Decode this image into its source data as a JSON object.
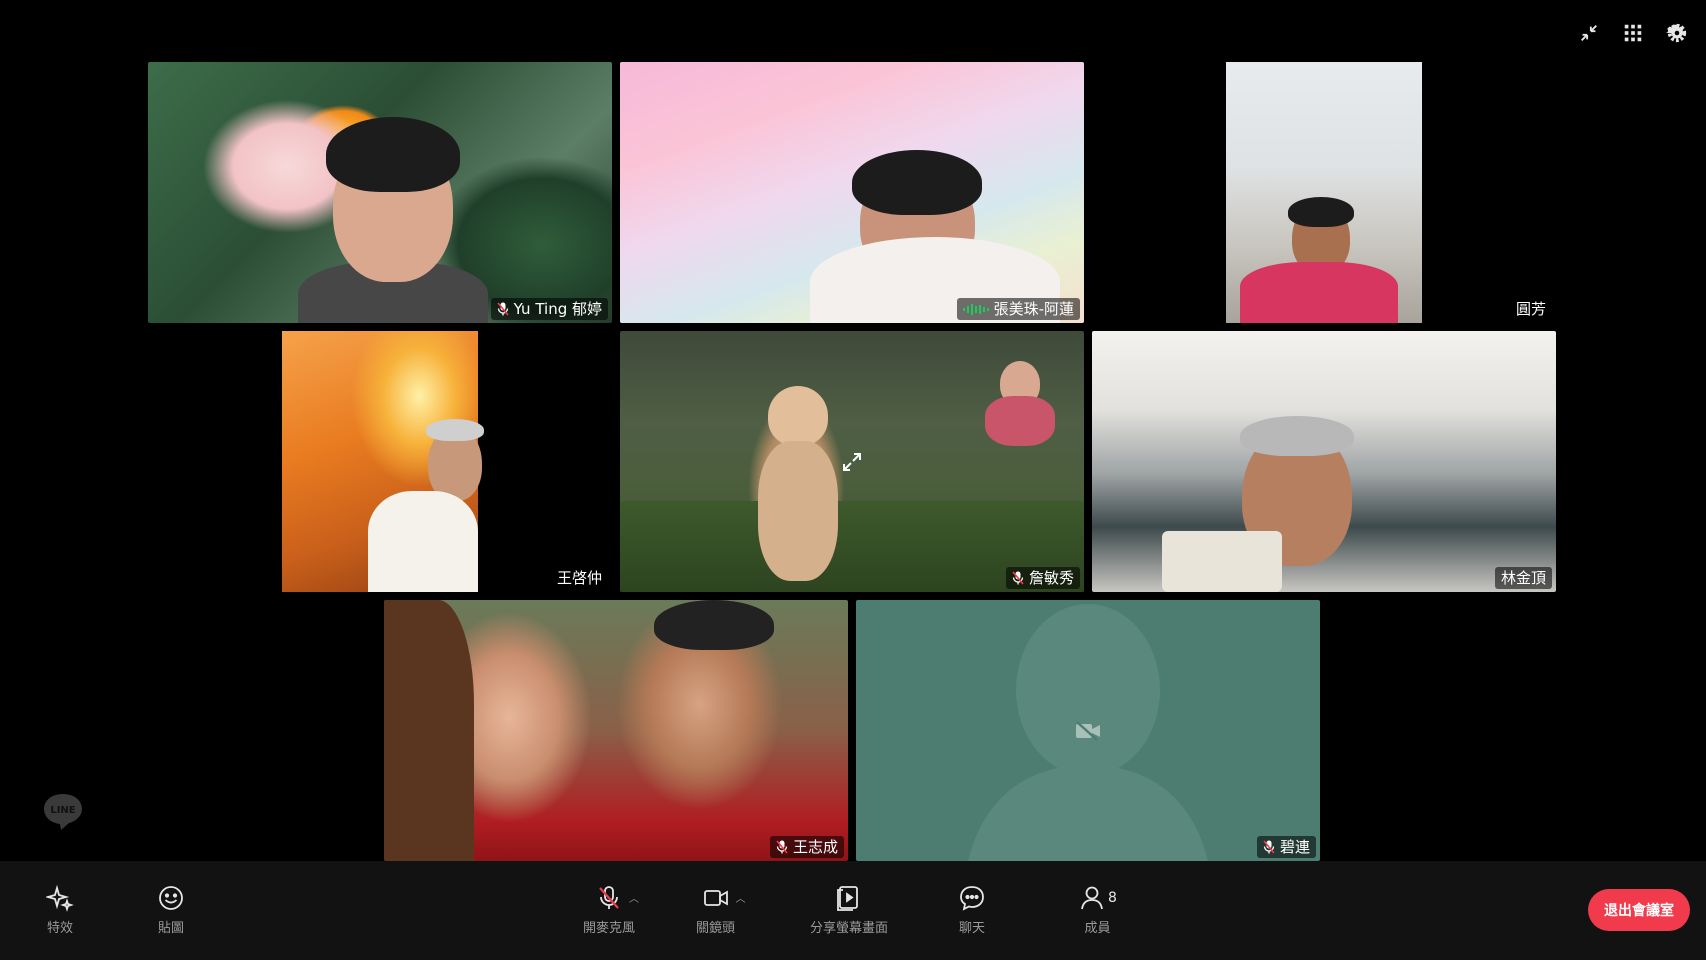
{
  "participants": [
    {
      "name": "Yu Ting 郁婷",
      "muted": true
    },
    {
      "name": "張美珠-阿蓮",
      "speaking": true
    },
    {
      "name": "圓芳"
    },
    {
      "name": "王啓仲"
    },
    {
      "name": "詹敏秀",
      "muted": true
    },
    {
      "name": "林金頂"
    },
    {
      "name": "王志成",
      "muted": true
    },
    {
      "name": "碧連",
      "muted": true,
      "camera_off": true
    }
  ],
  "logo": "LINE",
  "toolbar": {
    "effects": "特效",
    "stickers": "貼圖",
    "mic": "開麥克風",
    "camera": "關鏡頭",
    "share": "分享螢幕畫面",
    "chat": "聊天",
    "members": "成員",
    "member_count": "8",
    "exit": "退出會議室"
  },
  "colors": {
    "background": "#000000",
    "toolbar": "#121212",
    "exit_button": "#f13b4c",
    "speaking_outline": "#1fca5a",
    "placeholder_tile": "#4d7c70",
    "muted_mic": "#f13b4c"
  },
  "icons": [
    "minimize-icon",
    "grid-view-icon",
    "settings-icon",
    "sparkle-icon",
    "smiley-icon",
    "mic-off-icon",
    "video-camera-icon",
    "screen-share-icon",
    "chat-bubble-icon",
    "person-icon",
    "camera-off-icon",
    "expand-icon"
  ]
}
